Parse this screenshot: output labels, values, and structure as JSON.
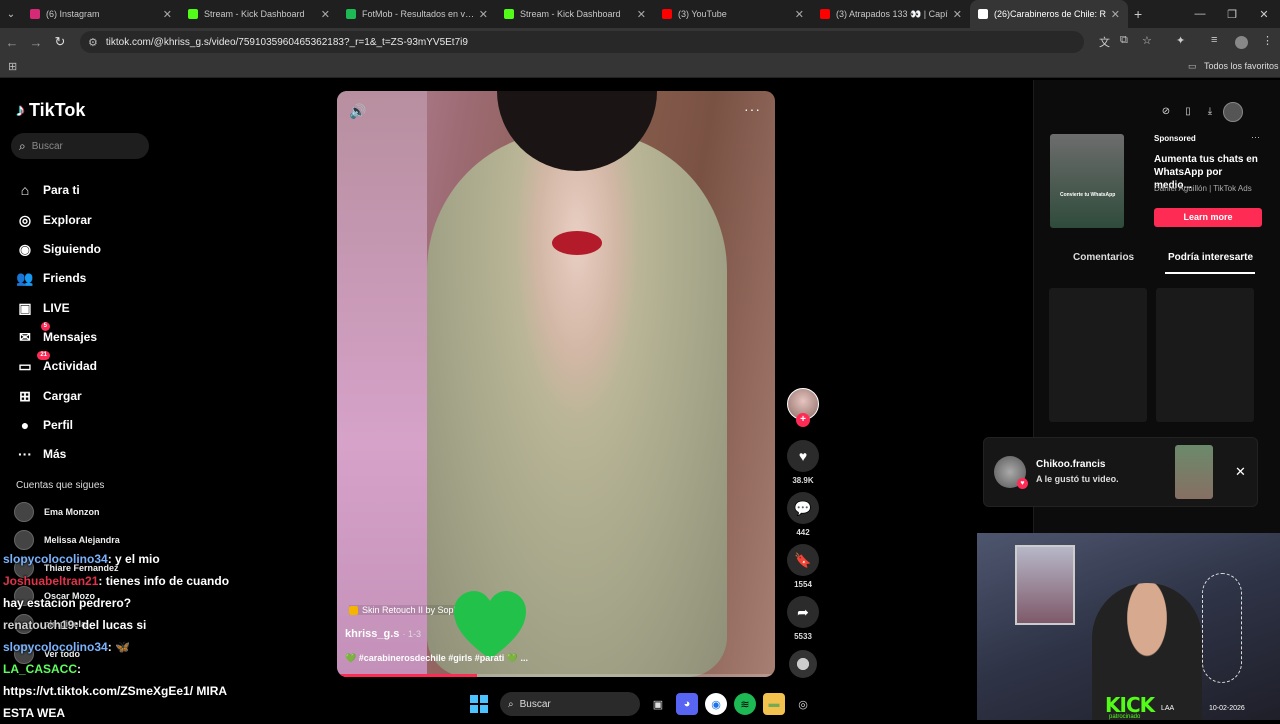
{
  "browser": {
    "tabs": [
      {
        "title": "(6) Instagram",
        "color": "#d62976"
      },
      {
        "title": "Stream - Kick Dashboard",
        "color": "#53fc18"
      },
      {
        "title": "FotMob - Resultados en vivo de",
        "color": "#1db954"
      },
      {
        "title": "Stream - Kick Dashboard",
        "color": "#53fc18"
      },
      {
        "title": "(3) YouTube",
        "color": "#ff0000"
      },
      {
        "title": "(3) Atrapados 133 👀 | Capí",
        "color": "#ff0000"
      },
      {
        "title": "(26)Carabineros de Chile: R",
        "color": "#ffffff",
        "active": true
      }
    ],
    "new_tab": "+",
    "url": "tiktok.com/@khriss_g.s/video/7591035960465362183?_r=1&_t=ZS-93mYV5Et7i9",
    "bookmarks_all": "Todos los favoritos"
  },
  "sidebar": {
    "logo": "TikTok",
    "search_placeholder": "Buscar",
    "nav": [
      {
        "label": "Para ti",
        "icon": "⌂"
      },
      {
        "label": "Explorar",
        "icon": "◎"
      },
      {
        "label": "Siguiendo",
        "icon": "◉"
      },
      {
        "label": "Friends",
        "icon": "👥"
      },
      {
        "label": "LIVE",
        "icon": "▣"
      },
      {
        "label": "Mensajes",
        "icon": "✉",
        "badge": "5"
      },
      {
        "label": "Actividad",
        "icon": "▭",
        "badge": "21"
      },
      {
        "label": "Cargar",
        "icon": "⊞"
      },
      {
        "label": "Perfil",
        "icon": "●"
      },
      {
        "label": "Más",
        "icon": "···"
      }
    ],
    "following_heading": "Cuentas que sigues",
    "following": [
      "Ema Monzon",
      "Melissa Alejandra",
      "Thiare Fernandez",
      "Oscar Mozo",
      "pimpinela",
      "Ver todo"
    ]
  },
  "video": {
    "effect": "Skin Retouch II by Sophie",
    "author": "khriss_g.s",
    "date": "1-3",
    "caption": "💚 #carabinerosdechile #girls #parati 💚 ...",
    "progress": 0.32
  },
  "actions": {
    "likes": "38.9K",
    "comments": "442",
    "saves": "1554",
    "shares": "5533"
  },
  "right_panel": {
    "ad_thumb_text": "Convierte tu WhatsApp",
    "sponsored": "Sponsored",
    "ad_title": "Aumenta tus chats en WhatsApp por medio...",
    "ad_source": "Daniel Aguillón | TikTok Ads",
    "learn_more": "Learn more",
    "tab_comments": "Comentarios",
    "tab_suggested": "Podría interesarte"
  },
  "notification": {
    "name": "Chikoo.francis",
    "message": "A le gustó tu video."
  },
  "chat": [
    {
      "user": "slopycolocolino34",
      "text": ": y el mio",
      "color": "#7bb3ff"
    },
    {
      "user": "Joshuabeltran21",
      "text": ": tienes info de cuando hay estacion pedrero?",
      "color": "#e0334a"
    },
    {
      "user": "renatouch19",
      "text": ": del lucas si",
      "color": "#d0d0d0"
    },
    {
      "user": "slopycolocolino34",
      "text": ": 🦋",
      "color": "#7bb3ff"
    },
    {
      "user": "LA_CASACC",
      "text": ":",
      "color": "#5cff5c"
    },
    {
      "user": "",
      "text": "https://vt.tiktok.com/ZSmeXgEe1/ MIRA ESTA WEA",
      "color": "#ffffff"
    }
  ],
  "webcam": {
    "brand": "KICK",
    "brand_sub": "patrocinado",
    "lang": "LAA",
    "date": "10-02-2026"
  },
  "taskbar": {
    "search_label": "Buscar"
  }
}
